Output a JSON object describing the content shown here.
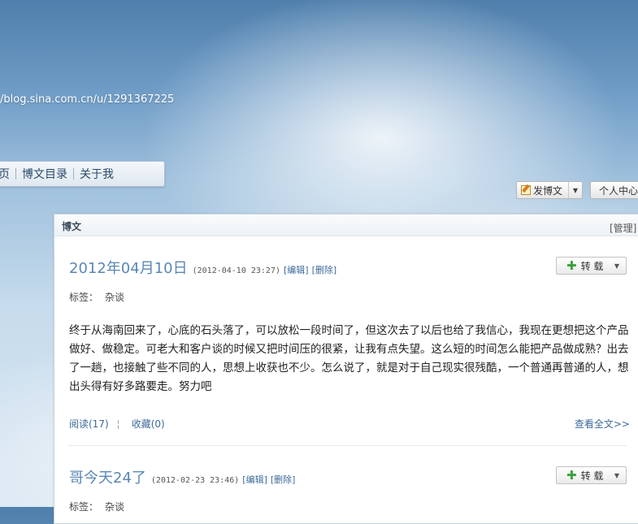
{
  "header": {
    "blog_url": "/blog.sina.com.cn/u/1291367225"
  },
  "nav": {
    "items": [
      "页",
      "博文目录",
      "关于我"
    ]
  },
  "toolbar": {
    "post_label": "发博文",
    "profile_label": "个人中心"
  },
  "panel": {
    "title": "博文",
    "manage": "[管理]"
  },
  "posts": [
    {
      "title": "2012年04月10日",
      "time": "(2012-04-10 23:27)",
      "edit": "[编辑]",
      "delete": "[删除]",
      "share": "转 载",
      "tag_label": "标签：",
      "tag_value": "杂谈",
      "body": "终于从海南回来了，心底的石头落了，可以放松一段时间了，但这次去了以后也给了我信心，我现在更想把这个产品做好、做稳定。可老大和客户谈的时候又把时间压的很紧，让我有点失望。这么短的时间怎么能把产品做成熟？出去了一趟，也接触了些不同的人，思想上收获也不少。怎么说了，就是对于自己现实很残酷，一个普通再普通的人，想出头得有好多路要走。努力吧",
      "read": "阅读(17)",
      "favorite": "收藏(0)",
      "more": "查看全文>>"
    },
    {
      "title": "哥今天24了",
      "time": "(2012-02-23 23:46)",
      "edit": "[编辑]",
      "delete": "[删除]",
      "share": "转 载",
      "tag_label": "标签：",
      "tag_value": "杂谈"
    }
  ]
}
